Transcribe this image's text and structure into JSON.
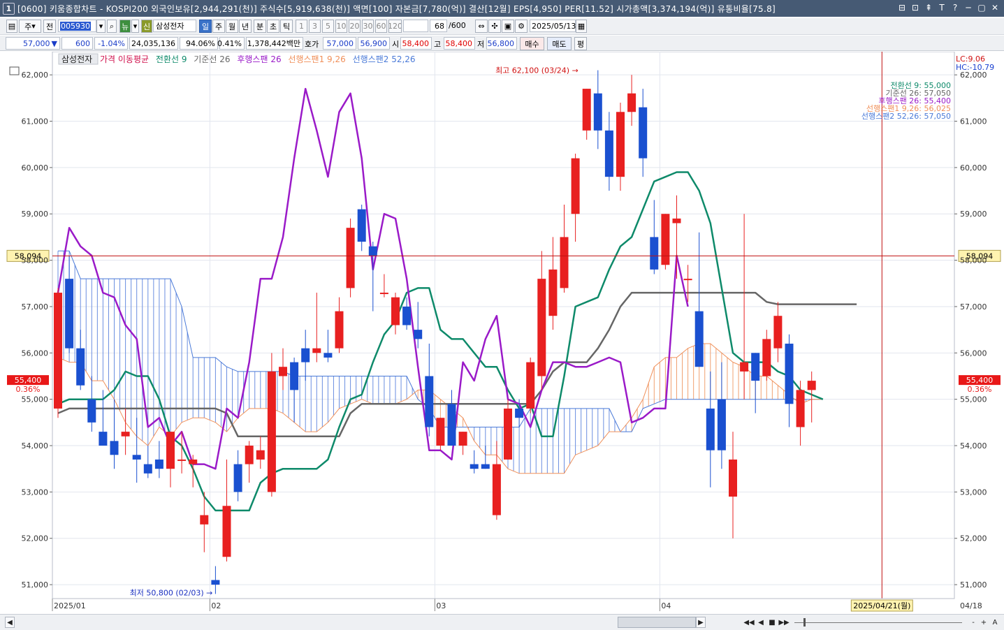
{
  "window": {
    "number": "1",
    "title": "[0600] 키움종합차트 - KOSPI200 외국인보유[2,944,291(천)] 주식수[5,919,638(천)] 액면[100] 자본금[7,780(억)] 결산[12월] EPS[4,950] PER[11.52] 시가총액[3,374,194(억)] 유통비율[75.8]",
    "controls": [
      "⊟",
      "⊡",
      "⇞",
      "T",
      "?",
      "─",
      "▢",
      "✕"
    ]
  },
  "toolbar1": {
    "mode1": "주",
    "mode2": "전",
    "code": "005930",
    "news": "뉴",
    "credit": "신",
    "stock_name": "삼성전자",
    "periods": [
      "일",
      "주",
      "월",
      "년",
      "분",
      "초",
      "틱"
    ],
    "minute_options": [
      "1",
      "3",
      "5",
      "10",
      "20",
      "30",
      "60",
      "120"
    ],
    "count": "68",
    "count_total": "/600",
    "date": "2025/05/13"
  },
  "toolbar2": {
    "price": "57,000",
    "change_arrow": "▼",
    "change": "600",
    "change_pct": "-1.04%",
    "volume": "24,035,136",
    "vol_ratio": "94.06%",
    "turnover": "0.41%",
    "amount": "1,378,442백만",
    "hoga_label": "호가",
    "ask": "57,000",
    "bid": "56,900",
    "open_label": "시",
    "open": "58,400",
    "high_label": "고",
    "high": "58,400",
    "low_label": "저",
    "low": "56,800",
    "buy_label": "매수",
    "sell_label": "매도",
    "flat_label": "평"
  },
  "legend": {
    "stock_tag": "삼성전자",
    "items": [
      {
        "label": "가격 이동평균",
        "color": "#d0104c"
      },
      {
        "label": "전환선 9",
        "color": "#0e8a6a"
      },
      {
        "label": "기준선 26",
        "color": "#666666"
      },
      {
        "label": "후행스팬 26",
        "color": "#9a1ac8"
      },
      {
        "label": "선행스팬1 9,26",
        "color": "#f0905a"
      },
      {
        "label": "선행스팬2 52,26",
        "color": "#4a7ad8"
      }
    ]
  },
  "right_top": {
    "lc": "LC:9.06",
    "hc": "HC:-10.79"
  },
  "right_legend": [
    {
      "text": "전환선 9: 55,000",
      "color": "#0e8a6a"
    },
    {
      "text": "기준선 26: 57,050",
      "color": "#666666"
    },
    {
      "text": "후행스팬 26: 55,400",
      "color": "#9a1ac8"
    },
    {
      "text": "선행스팬1 9,26: 56,025",
      "color": "#f0905a"
    },
    {
      "text": "선행스팬2 52,26: 57,050",
      "color": "#4a7ad8"
    }
  ],
  "colors": {
    "up": "#e82020",
    "down": "#1a50d0",
    "crosshair": "#c01010",
    "grid": "#e2e6ee"
  },
  "chart_data": {
    "type": "candlestick",
    "ylim": [
      50700,
      62500
    ],
    "y_ticks": [
      51000,
      52000,
      53000,
      54000,
      55000,
      56000,
      57000,
      58000,
      59000,
      60000,
      61000,
      62000
    ],
    "y_tick_labels": [
      "51,000",
      "52,000",
      "53,000",
      "54,000",
      "55,000",
      "56,000",
      "57,000",
      "58,000",
      "59,000",
      "60,000",
      "61,000",
      "62,000"
    ],
    "x_labels": [
      {
        "label": "2025/01",
        "index": 0
      },
      {
        "label": "02",
        "index": 14
      },
      {
        "label": "03",
        "index": 34
      },
      {
        "label": "04",
        "index": 54
      }
    ],
    "corner_date": "04/18",
    "crosshair": {
      "price": 58094,
      "price_label": "58,094",
      "date_label": "2025/04/21(월)",
      "index": 73.25
    },
    "current": {
      "price": 55400,
      "label": "55,400",
      "pct": "0.36%"
    },
    "annotations": {
      "high": {
        "text": "최고 62,100 (03/24)",
        "index": 48
      },
      "low": {
        "text": "최저 50,800 (02/03)",
        "index": 14
      }
    },
    "candles": [
      {
        "o": 54800,
        "h": 57400,
        "l": 54600,
        "c": 57300
      },
      {
        "o": 57600,
        "h": 58100,
        "l": 56000,
        "c": 56100
      },
      {
        "o": 56100,
        "h": 56500,
        "l": 55200,
        "c": 55300
      },
      {
        "o": 55000,
        "h": 55500,
        "l": 54300,
        "c": 54500
      },
      {
        "o": 54300,
        "h": 55200,
        "l": 54000,
        "c": 54000
      },
      {
        "o": 54100,
        "h": 55000,
        "l": 53500,
        "c": 53800
      },
      {
        "o": 54200,
        "h": 54800,
        "l": 53800,
        "c": 54300
      },
      {
        "o": 53800,
        "h": 54600,
        "l": 53200,
        "c": 53700
      },
      {
        "o": 53600,
        "h": 54000,
        "l": 53300,
        "c": 53400
      },
      {
        "o": 53700,
        "h": 54100,
        "l": 53300,
        "c": 53500
      },
      {
        "o": 53500,
        "h": 54300,
        "l": 53100,
        "c": 54300
      },
      {
        "o": 53700,
        "h": 54300,
        "l": 53400,
        "c": 53700
      },
      {
        "o": 53600,
        "h": 53800,
        "l": 53100,
        "c": 53700
      },
      {
        "o": 52300,
        "h": 53000,
        "l": 51700,
        "c": 52500
      },
      {
        "o": 51100,
        "h": 51400,
        "l": 50800,
        "c": 51000
      },
      {
        "o": 51600,
        "h": 53700,
        "l": 51500,
        "c": 52700
      },
      {
        "o": 53600,
        "h": 53900,
        "l": 52800,
        "c": 53000
      },
      {
        "o": 53600,
        "h": 54100,
        "l": 53200,
        "c": 54000
      },
      {
        "o": 53700,
        "h": 54200,
        "l": 53500,
        "c": 53900
      },
      {
        "o": 53000,
        "h": 56000,
        "l": 52900,
        "c": 55600
      },
      {
        "o": 55500,
        "h": 56100,
        "l": 55200,
        "c": 55700
      },
      {
        "o": 55800,
        "h": 55900,
        "l": 54500,
        "c": 55200
      },
      {
        "o": 56100,
        "h": 56500,
        "l": 55400,
        "c": 55800
      },
      {
        "o": 56000,
        "h": 57300,
        "l": 55800,
        "c": 56100
      },
      {
        "o": 56000,
        "h": 56500,
        "l": 55800,
        "c": 55900
      },
      {
        "o": 56100,
        "h": 57200,
        "l": 56000,
        "c": 56900
      },
      {
        "o": 57400,
        "h": 58900,
        "l": 57200,
        "c": 58700
      },
      {
        "o": 59100,
        "h": 59200,
        "l": 58200,
        "c": 58400
      },
      {
        "o": 58300,
        "h": 58400,
        "l": 56900,
        "c": 58100
      },
      {
        "o": 57300,
        "h": 57700,
        "l": 57200,
        "c": 57300
      },
      {
        "o": 56600,
        "h": 57300,
        "l": 56400,
        "c": 57200
      },
      {
        "o": 57000,
        "h": 57200,
        "l": 56500,
        "c": 56600
      },
      {
        "o": 56500,
        "h": 57100,
        "l": 56100,
        "c": 56300
      },
      {
        "o": 55500,
        "h": 56200,
        "l": 54200,
        "c": 54400
      },
      {
        "o": 54000,
        "h": 54600,
        "l": 53900,
        "c": 54600
      },
      {
        "o": 54900,
        "h": 55200,
        "l": 54000,
        "c": 54000
      },
      {
        "o": 54000,
        "h": 54300,
        "l": 53800,
        "c": 54300
      },
      {
        "o": 53600,
        "h": 53900,
        "l": 53400,
        "c": 53500
      },
      {
        "o": 53600,
        "h": 54000,
        "l": 53500,
        "c": 53500
      },
      {
        "o": 52500,
        "h": 54100,
        "l": 52400,
        "c": 53600
      },
      {
        "o": 53700,
        "h": 55000,
        "l": 53700,
        "c": 54800
      },
      {
        "o": 54800,
        "h": 55000,
        "l": 54400,
        "c": 54600
      },
      {
        "o": 54800,
        "h": 55900,
        "l": 54700,
        "c": 55800
      },
      {
        "o": 55500,
        "h": 58200,
        "l": 55200,
        "c": 57600
      },
      {
        "o": 56800,
        "h": 58500,
        "l": 56500,
        "c": 57800
      },
      {
        "o": 57400,
        "h": 59200,
        "l": 57300,
        "c": 58500
      },
      {
        "o": 59000,
        "h": 60300,
        "l": 58400,
        "c": 60200
      },
      {
        "o": 60800,
        "h": 61700,
        "l": 60600,
        "c": 61700
      },
      {
        "o": 61600,
        "h": 62100,
        "l": 60400,
        "c": 60800
      },
      {
        "o": 60800,
        "h": 61200,
        "l": 59500,
        "c": 59800
      },
      {
        "o": 59800,
        "h": 61400,
        "l": 59500,
        "c": 61200
      },
      {
        "o": 61200,
        "h": 62000,
        "l": 60900,
        "c": 61600
      },
      {
        "o": 61300,
        "h": 61700,
        "l": 59800,
        "c": 60200
      },
      {
        "o": 58500,
        "h": 59300,
        "l": 57700,
        "c": 57800
      },
      {
        "o": 57900,
        "h": 59000,
        "l": 57800,
        "c": 59000
      },
      {
        "o": 58800,
        "h": 59400,
        "l": 57600,
        "c": 58900
      },
      {
        "o": 57600,
        "h": 57900,
        "l": 57100,
        "c": 57600
      },
      {
        "o": 56900,
        "h": 58600,
        "l": 55700,
        "c": 55700
      },
      {
        "o": 54800,
        "h": 55600,
        "l": 53100,
        "c": 53900
      },
      {
        "o": 55000,
        "h": 55800,
        "l": 53500,
        "c": 53900
      },
      {
        "o": 52900,
        "h": 54300,
        "l": 52000,
        "c": 53700
      },
      {
        "o": 55600,
        "h": 59000,
        "l": 55000,
        "c": 55800
      },
      {
        "o": 56000,
        "h": 56000,
        "l": 54700,
        "c": 55400
      },
      {
        "o": 55500,
        "h": 56500,
        "l": 55400,
        "c": 56300
      },
      {
        "o": 56100,
        "h": 57100,
        "l": 55800,
        "c": 56800
      },
      {
        "o": 56200,
        "h": 56400,
        "l": 54400,
        "c": 54900
      },
      {
        "o": 54400,
        "h": 55400,
        "l": 54000,
        "c": 55200
      },
      {
        "o": 55200,
        "h": 55600,
        "l": 54500,
        "c": 55400
      }
    ],
    "tenkan": [
      54900,
      55000,
      55000,
      55000,
      55000,
      55200,
      55600,
      55500,
      55500,
      55000,
      54200,
      54000,
      53500,
      52900,
      52600,
      52600,
      52600,
      52600,
      53200,
      53400,
      53500,
      53500,
      53500,
      53500,
      53700,
      54400,
      55000,
      55100,
      55800,
      56400,
      56700,
      57300,
      57400,
      57400,
      56500,
      56300,
      56300,
      56000,
      55700,
      55700,
      55200,
      54800,
      54900,
      54200,
      54200,
      55500,
      57000,
      57100,
      57200,
      57800,
      58300,
      58500,
      59100,
      59700,
      59800,
      59900,
      59900,
      59500,
      58800,
      57400,
      56000,
      55800,
      55800,
      55800,
      55600,
      55500,
      55200,
      55100,
      55000
    ],
    "kijun": [
      54700,
      54800,
      54800,
      54800,
      54800,
      54800,
      54800,
      54800,
      54800,
      54800,
      54800,
      54800,
      54800,
      54800,
      54800,
      54700,
      54200,
      54200,
      54200,
      54200,
      54200,
      54200,
      54200,
      54200,
      54200,
      54200,
      54700,
      54900,
      54900,
      54900,
      54900,
      54900,
      54900,
      54900,
      54900,
      54900,
      54900,
      54900,
      54900,
      54900,
      54900,
      54900,
      54900,
      55200,
      55600,
      55800,
      55800,
      55800,
      56100,
      56500,
      57000,
      57300,
      57300,
      57300,
      57300,
      57300,
      57300,
      57300,
      57300,
      57300,
      57300,
      57300,
      57300,
      57100,
      57050,
      57050,
      57050,
      57050,
      57050,
      57050,
      57050,
      57050
    ],
    "chikou": [
      57300,
      58700,
      58300,
      58100,
      57300,
      57200,
      56600,
      56300,
      54400,
      54600,
      54000,
      54300,
      53600,
      53600,
      53500,
      54800,
      54600,
      55800,
      57600,
      57600,
      58500,
      60200,
      61700,
      60800,
      59800,
      61200,
      61600,
      60200,
      57800,
      59000,
      58900,
      57600,
      55700,
      53900,
      53900,
      53700,
      55800,
      55400,
      56300,
      56800,
      55000,
      54900,
      54400,
      55200,
      55800,
      55800,
      55700,
      55700,
      55800,
      55900,
      55800,
      54500,
      54600,
      54800,
      54800,
      58100,
      57000
    ],
    "senkou1": [
      55900,
      55800,
      55800,
      55400,
      55400,
      55000,
      54500,
      54200,
      54000,
      54400,
      54200,
      54500,
      54600,
      54600,
      54500,
      54300,
      54600,
      54800,
      54800,
      54800,
      54700,
      54500,
      54300,
      54300,
      54500,
      54800,
      54900,
      55000,
      54900,
      54900,
      54900,
      55000,
      55200,
      55200,
      55000,
      54800,
      54600,
      54100,
      53800,
      53800,
      53500,
      53400,
      53400,
      53400,
      53400,
      53400,
      53800,
      53900,
      54000,
      54300,
      54300,
      54600,
      55000,
      55700,
      55900,
      55900,
      56100,
      56200,
      56200,
      56000,
      55800,
      55700,
      55500,
      55500,
      55300,
      55100,
      54900,
      55000,
      55000
    ],
    "senkou2": [
      58200,
      58200,
      57600,
      57600,
      57600,
      57600,
      57600,
      57600,
      57600,
      57600,
      57600,
      57000,
      55900,
      55900,
      55900,
      55700,
      55600,
      55600,
      55600,
      55600,
      55600,
      55500,
      55500,
      55500,
      55500,
      55500,
      55500,
      55500,
      55500,
      55500,
      55500,
      55500,
      55000,
      54800,
      54400,
      54400,
      54400,
      54400,
      54400,
      54400,
      54400,
      54400,
      54800,
      54800,
      54800,
      54800,
      54800,
      54800,
      54800,
      54800,
      54300,
      54300,
      54800,
      54900,
      55000,
      55000,
      55000,
      55000,
      55000,
      55000,
      55000,
      55000,
      55000,
      55000,
      55000,
      55000,
      55000,
      55000,
      55000
    ]
  },
  "bottom": {
    "nav": [
      "◀",
      "▶",
      "◀◀",
      "■",
      "▶▶"
    ],
    "tools": [
      "-",
      "+",
      "A"
    ]
  }
}
